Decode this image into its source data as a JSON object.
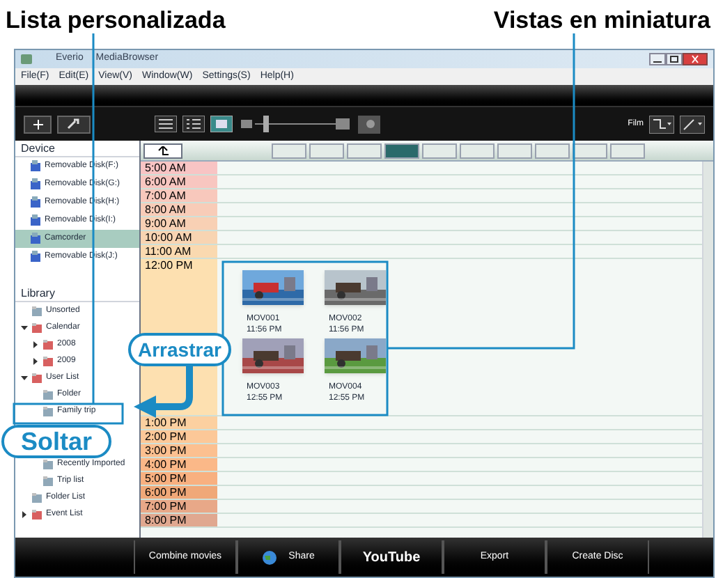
{
  "callouts": {
    "custom_list": "Lista personalizada",
    "thumbnails": "Vistas en miniatura",
    "drag": "Arrastrar",
    "drop": "Soltar"
  },
  "window": {
    "title": "Everio MediaBrowser"
  },
  "menu": [
    "File(F)",
    "Edit(E)",
    "View(V)",
    "Window(W)",
    "Settings(S)",
    "Help(H)"
  ],
  "toolbar": {
    "filter_label": "Film"
  },
  "sidebar": {
    "device_heading": "Device",
    "devices": [
      {
        "label": "Removable Disk(F:)",
        "selected": false
      },
      {
        "label": "Removable Disk(G:)",
        "selected": false
      },
      {
        "label": "Removable Disk(H:)",
        "selected": false
      },
      {
        "label": "Removable Disk(I:)",
        "selected": false
      },
      {
        "label": "Camcorder",
        "selected": true
      },
      {
        "label": "Removable Disk(J:)",
        "selected": false
      }
    ],
    "library_heading": "Library",
    "library": [
      {
        "label": "Unsorted",
        "kind": "leaf"
      },
      {
        "label": "Calendar",
        "kind": "folder",
        "expanded": true,
        "children": [
          {
            "label": "2008",
            "kind": "folder",
            "expanded": false
          },
          {
            "label": "2009",
            "kind": "folder",
            "expanded": false
          }
        ]
      },
      {
        "label": "User List",
        "kind": "folder",
        "expanded": true,
        "children": [
          {
            "label": "Folder",
            "kind": "leaf"
          },
          {
            "label": "Family trip",
            "kind": "leaf"
          },
          {
            "label": "Recently Imported",
            "kind": "leaf"
          },
          {
            "label": "Trip list",
            "kind": "leaf"
          }
        ]
      },
      {
        "label": "Folder List",
        "kind": "leaf"
      },
      {
        "label": "Event List",
        "kind": "folder",
        "expanded": false
      }
    ]
  },
  "scale_buttons": [
    {
      "selected": false
    },
    {
      "selected": false
    },
    {
      "selected": false
    },
    {
      "selected": true
    },
    {
      "selected": false
    },
    {
      "selected": false
    },
    {
      "selected": false
    },
    {
      "selected": false
    },
    {
      "selected": false
    },
    {
      "selected": false
    }
  ],
  "timeline": [
    {
      "time": "5:00 AM"
    },
    {
      "time": "6:00 AM"
    },
    {
      "time": "7:00 AM"
    },
    {
      "time": "8:00 AM"
    },
    {
      "time": "9:00 AM"
    },
    {
      "time": "10:00 AM"
    },
    {
      "time": "11:00 AM"
    },
    {
      "time": "12:00 PM",
      "thumbnails": [
        {
          "name": "MOV001",
          "time": "11:56 PM"
        },
        {
          "name": "MOV002",
          "time": "11:56 PM"
        },
        {
          "name": "MOV003",
          "time": "12:55 PM"
        },
        {
          "name": "MOV004",
          "time": "12:55 PM"
        }
      ]
    },
    {
      "time": "1:00 PM"
    },
    {
      "time": "2:00 PM"
    },
    {
      "time": "3:00 PM"
    },
    {
      "time": "4:00 PM"
    },
    {
      "time": "5:00 PM"
    },
    {
      "time": "6:00 PM"
    },
    {
      "time": "7:00 PM"
    },
    {
      "time": "8:00 PM"
    }
  ],
  "bottom_bar": [
    {
      "label": "Combine movies",
      "kind": "text"
    },
    {
      "label": "Share",
      "kind": "share"
    },
    {
      "label": "YouTube",
      "kind": "youtube"
    },
    {
      "label": "Export",
      "kind": "text"
    },
    {
      "label": "Create Disc",
      "kind": "text"
    }
  ]
}
